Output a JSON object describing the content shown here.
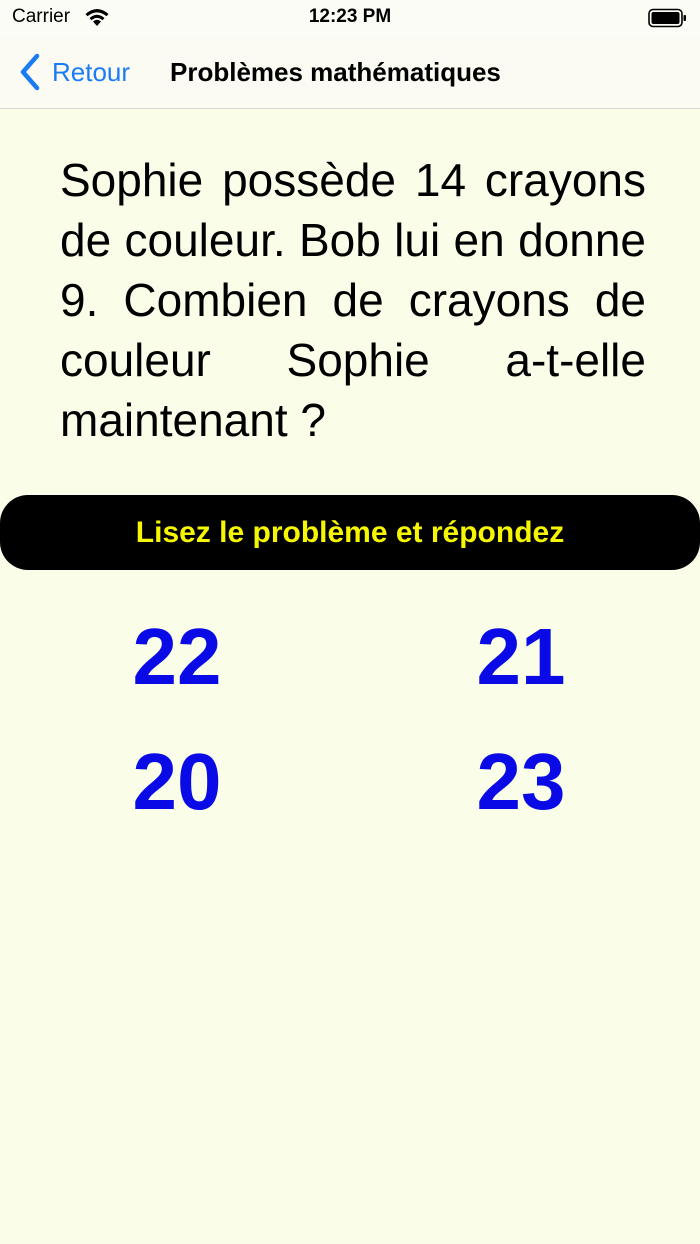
{
  "status_bar": {
    "carrier": "Carrier",
    "time": "12:23 PM",
    "icons": [
      "wifi-icon",
      "battery-icon"
    ]
  },
  "nav": {
    "back_label": "Retour",
    "title": "Problèmes mathématiques",
    "accent_color": "#1a7cf5"
  },
  "problem": {
    "text": "Sophie possède 14 crayons de couleur. Bob lui en donne 9. Combien de crayons de couleur Sophie a-t-elle maintenant ?"
  },
  "instruction": {
    "text": "Lisez le problème et répondez",
    "text_color": "#f6f600",
    "background": "#000000"
  },
  "answers": [
    "22",
    "21",
    "20",
    "23"
  ],
  "colors": {
    "background": "#fafee9",
    "answer_color": "#0a0ae6"
  }
}
